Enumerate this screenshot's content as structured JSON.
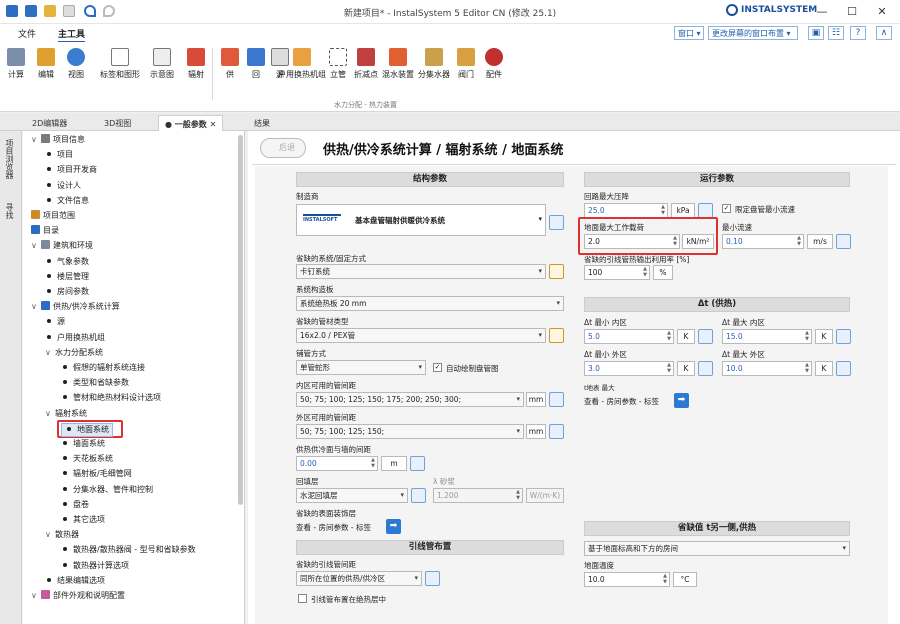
{
  "window": {
    "title": "新建项目* - InstalSystem 5 Editor CN (修改 25.1)",
    "brand": "INSTALSYSTEM",
    "minimize": "—",
    "maximize": "☐",
    "close": "✕"
  },
  "menubar": {
    "file": "文件",
    "main_tools": "主工具",
    "window_sel": "窗口",
    "screen_layout_sel": "更改屏幕的窗口布置",
    "arrow": "▾",
    "collapse": "∧"
  },
  "ribbon": {
    "buttons": [
      "计算",
      "编辑",
      "视图",
      "标签和图形",
      "示意图",
      "辐射",
      "供",
      "回",
      "源",
      "户用换热机组",
      "立管",
      "折减点",
      "混水装置",
      "分集水器",
      "阀门",
      "配件"
    ],
    "group_label": "水力分配 - 热力装置"
  },
  "tabs": {
    "tab1": "2D编辑器",
    "tab2": "3D视图",
    "tab3": "● 一般参数",
    "tab4": "结果",
    "close": "✕"
  },
  "side_tabs": {
    "browser": "项目浏览器",
    "search": "寻找"
  },
  "tree": [
    {
      "label": "项目信息",
      "level": 0,
      "expander": "∨",
      "icon": "#7a7a7a"
    },
    {
      "label": "项目",
      "level": 1
    },
    {
      "label": "项目开发商",
      "level": 1
    },
    {
      "label": "设计人",
      "level": 1
    },
    {
      "label": "文件信息",
      "level": 1
    },
    {
      "label": "项目范围",
      "level": 0,
      "icon": "#d08a2a"
    },
    {
      "label": "目录",
      "level": 0,
      "icon": "#2b6cc4"
    },
    {
      "label": "建筑和环境",
      "level": 0,
      "expander": "∨",
      "icon": "#7a8a9a"
    },
    {
      "label": "气象参数",
      "level": 1
    },
    {
      "label": "楼层管理",
      "level": 1
    },
    {
      "label": "房间参数",
      "level": 1
    },
    {
      "label": "供热/供冷系统计算",
      "level": 0,
      "expander": "∨",
      "icon": "#2b6cc4"
    },
    {
      "label": "源",
      "level": 1
    },
    {
      "label": "户用换热机组",
      "level": 1
    },
    {
      "label": "水力分配系统",
      "level": 1,
      "expander": "∨",
      "nodot": true
    },
    {
      "label": "假想的辐射系统连接",
      "level": 2
    },
    {
      "label": "类型和省缺参数",
      "level": 2
    },
    {
      "label": "管材和绝热材料设计选项",
      "level": 2
    },
    {
      "label": "辐射系统",
      "level": 1,
      "expander": "∨",
      "nodot": true
    },
    {
      "label": "地面系统",
      "level": 2,
      "selected": true
    },
    {
      "label": "墙面系统",
      "level": 2
    },
    {
      "label": "天花板系统",
      "level": 2
    },
    {
      "label": "辐射板/毛细管网",
      "level": 2
    },
    {
      "label": "分集水器、管件和控制",
      "level": 2
    },
    {
      "label": "盘卷",
      "level": 2
    },
    {
      "label": "其它选项",
      "level": 2
    },
    {
      "label": "散热器",
      "level": 1,
      "expander": "∨",
      "nodot": true
    },
    {
      "label": "散热器/散热器阀 - 型号和省缺参数",
      "level": 2
    },
    {
      "label": "散热器计算选项",
      "level": 2
    },
    {
      "label": "结果编辑选项",
      "level": 1
    },
    {
      "label": "部件外观和说明配置",
      "level": 0,
      "expander": "∨",
      "icon": "#c45a9a"
    }
  ],
  "page": {
    "back": "后退",
    "title": "供热/供冷系统计算 / 辐射系统 / 地面系统"
  },
  "structure": {
    "header": "结构参数",
    "manufacturer_label": "制造商",
    "manufacturer_logo": "INSTALSOFT",
    "manufacturer_value": "基本盘管辐射供暖供冷系统",
    "system_label": "省缺的系统/固定方式",
    "system_value": "卡钉系统",
    "board_label": "系统构造板",
    "board_value": "系统绝热板 20 mm",
    "pipe_label": "省缺的管材类型",
    "pipe_value": "16x2.0 / PEX管",
    "laying_label": "铺管方式",
    "laying_value": "单管蛇形",
    "auto_draw_label": "自动绘制盘管图",
    "inner_spacing_label": "内区可用的管间距",
    "inner_spacing_value": "50; 75; 100; 125; 150; 175; 200; 250; 300;",
    "outer_spacing_label": "外区可用的管间距",
    "outer_spacing_value": "50; 75; 100; 125; 150;",
    "wall_gap_label": "供热供冷面与墙的间距",
    "wall_gap_value": "0.00",
    "screed_label": "回填层",
    "screed_value": "水泥回填层",
    "lambda_label": "λ 砂浆",
    "lambda_value": "1.200",
    "lambda_unit": "W/(m·K)",
    "finish_label": "省缺的表面装饰层",
    "finish_link": "查看 - 房间参数 - 标签",
    "unit_mm": "mm",
    "unit_m": "m",
    "check": "✓"
  },
  "leads": {
    "header": "引线管布置",
    "arrangement_label": "省缺的引线管间距",
    "arrangement_value": "同所在位置的供热/供冷区",
    "insulation_label": "引线管布置在绝热层中"
  },
  "operation": {
    "header": "运行参数",
    "max_dp_label": "回路最大压降",
    "max_dp_value": "25.0",
    "max_dp_unit": "kPa",
    "limit_flow_label": "限定盘管最小流速",
    "max_load_label": "地面最大工作载荷",
    "max_load_value": "2.0",
    "max_load_unit": "kN/m²",
    "min_flow_label": "最小流速",
    "min_flow_value": "0.10",
    "min_flow_unit": "m/s",
    "util_label": "省缺的引线管热输出利用率 [%]",
    "util_value": "100",
    "util_unit": "%"
  },
  "dt": {
    "header": "Δt (供热)",
    "min_inner_label": "Δt 最小 内区",
    "min_inner_value": "5.0",
    "max_inner_label": "Δt 最大 内区",
    "max_inner_value": "15.0",
    "min_outer_label": "Δt 最小 外区",
    "min_outer_value": "3.0",
    "max_outer_label": "Δt 最大 外区",
    "max_outer_value": "10.0",
    "unit": "K",
    "tfloor_label": "t地表 最大",
    "tfloor_link": "查看 - 房间参数 - 标签"
  },
  "defaults": {
    "header": "省缺值 t另一侧,供热",
    "method_value": "基于地面标高和下方的房间",
    "ground_label": "地面温度",
    "ground_value": "10.0",
    "ground_unit": "°C"
  },
  "colors": {
    "accent": "#1f5fae",
    "highlight": "#e03030",
    "link_button": "#2b7bd4"
  }
}
